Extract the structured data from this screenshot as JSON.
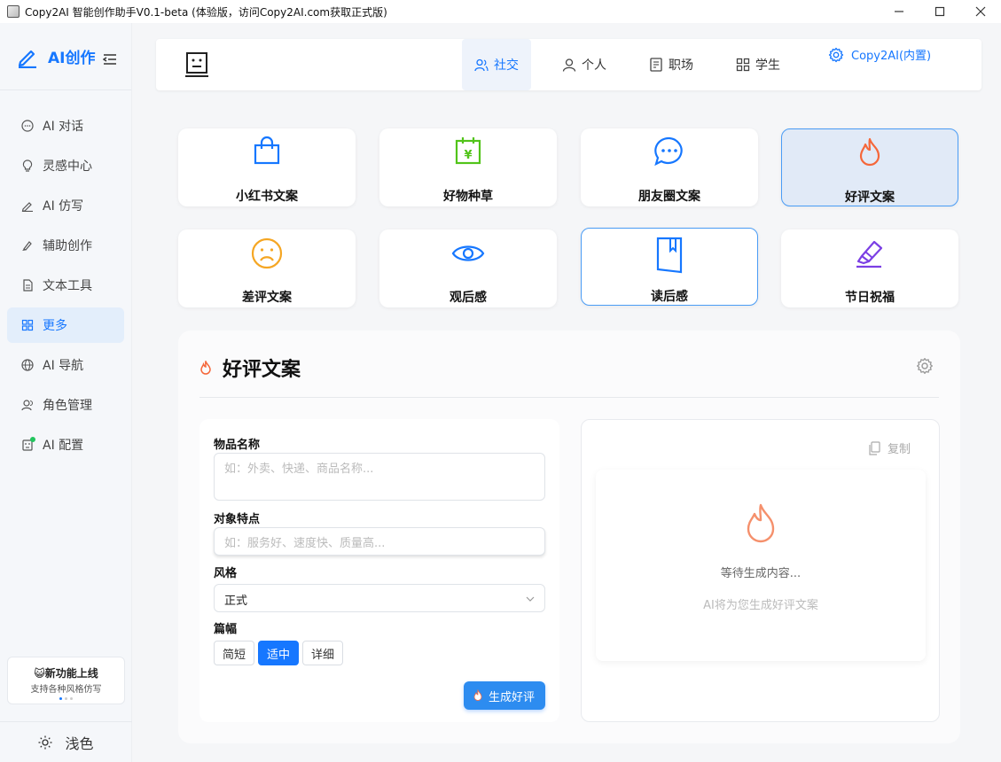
{
  "window": {
    "title": "Copy2AI 智能创作助手V0.1-beta (体验版，访问Copy2AI.com获取正式版)"
  },
  "sidebar": {
    "brand": "AI创作",
    "items": [
      {
        "label": "AI 对话",
        "icon": "chat-icon"
      },
      {
        "label": "灵感中心",
        "icon": "bulb-icon"
      },
      {
        "label": "AI 仿写",
        "icon": "pen-icon"
      },
      {
        "label": "辅助创作",
        "icon": "brush-icon"
      },
      {
        "label": "文本工具",
        "icon": "file-icon"
      },
      {
        "label": "更多",
        "icon": "grid-icon"
      },
      {
        "label": "AI 导航",
        "icon": "globe-icon"
      },
      {
        "label": "角色管理",
        "icon": "users-icon"
      },
      {
        "label": "AI 配置",
        "icon": "robot-icon"
      }
    ],
    "active_item": "更多",
    "promo": {
      "title": "😺新功能上线",
      "subtitle": "支持各种风格仿写"
    },
    "theme_label": "浅色"
  },
  "topbar": {
    "tabs": [
      {
        "label": "社交",
        "icon": "users-icon"
      },
      {
        "label": "个人",
        "icon": "user-icon"
      },
      {
        "label": "职场",
        "icon": "doc-icon"
      },
      {
        "label": "学生",
        "icon": "grid-icon"
      }
    ],
    "active_tab": "社交",
    "settings_label": "Copy2AI(内置)"
  },
  "cards": [
    {
      "label": "小红书文案",
      "icon": "bag-icon"
    },
    {
      "label": "好物种草",
      "icon": "calendar-yen-icon"
    },
    {
      "label": "朋友圈文案",
      "icon": "chat-bubble-icon"
    },
    {
      "label": "好评文案",
      "icon": "fire-icon"
    },
    {
      "label": "差评文案",
      "icon": "frown-icon"
    },
    {
      "label": "观后感",
      "icon": "eye-icon"
    },
    {
      "label": "读后感",
      "icon": "book-icon"
    },
    {
      "label": "节日祝福",
      "icon": "highlighter-icon"
    }
  ],
  "selected_card": "好评文案",
  "panel": {
    "title": "好评文案",
    "fields": {
      "item_name_label": "物品名称",
      "item_name_placeholder": "如：外卖、快递、商品名称...",
      "features_label": "对象特点",
      "features_placeholder": "如：服务好、速度快、质量高...",
      "style_label": "风格",
      "style_value": "正式",
      "length_label": "篇幅",
      "length_options": [
        "简短",
        "适中",
        "详细"
      ],
      "length_selected": "适中"
    },
    "generate_label": "生成好评",
    "copy_label": "复制",
    "output_waiting": "等待生成内容...",
    "output_hint": "AI将为您生成好评文案"
  },
  "colors": {
    "accent": "#1677ff",
    "fire": "#f5673a",
    "green": "#52c41a",
    "yellow": "#f5a623",
    "purple": "#7b3fe4"
  }
}
